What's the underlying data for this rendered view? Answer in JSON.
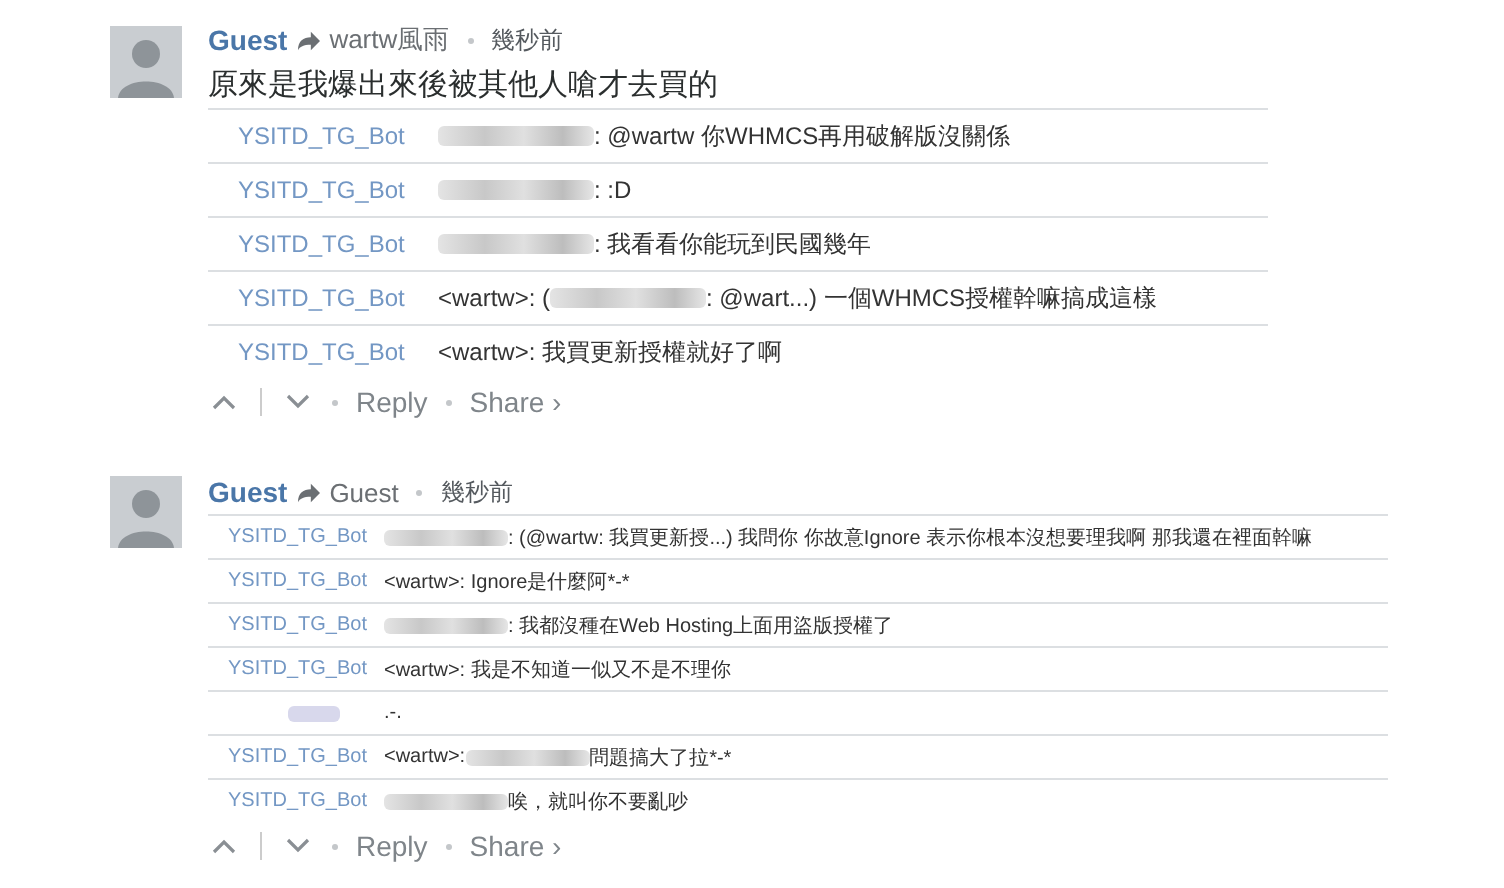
{
  "comments": [
    {
      "author": "Guest",
      "reply_to": "wartw風雨",
      "time": "幾秒前",
      "body": "原來是我爆出來後被其他人嗆才去買的",
      "compact": false,
      "lines": [
        {
          "author": "YSITD_TG_Bot",
          "parts": [
            {
              "kind": "blur"
            },
            {
              "kind": "text",
              "text": ": @wartw 你WHMCS再用破解版沒關係"
            }
          ]
        },
        {
          "author": "YSITD_TG_Bot",
          "parts": [
            {
              "kind": "blur"
            },
            {
              "kind": "text",
              "text": ": :D"
            }
          ]
        },
        {
          "author": "YSITD_TG_Bot",
          "parts": [
            {
              "kind": "blur"
            },
            {
              "kind": "text",
              "text": ": 我看看你能玩到民國幾年"
            }
          ]
        },
        {
          "author": "YSITD_TG_Bot",
          "parts": [
            {
              "kind": "text",
              "text": "<wartw>: ("
            },
            {
              "kind": "blur"
            },
            {
              "kind": "text",
              "text": ": @wart...) 一個WHMCS授權幹嘛搞成這樣"
            }
          ]
        },
        {
          "author": "YSITD_TG_Bot",
          "parts": [
            {
              "kind": "text",
              "text": "<wartw>: 我買更新授權就好了啊"
            }
          ]
        }
      ],
      "actions": [
        "Reply",
        "Share ›"
      ]
    },
    {
      "author": "Guest",
      "reply_to": "Guest",
      "time": "幾秒前",
      "compact": true,
      "lines": [
        {
          "author": "YSITD_TG_Bot",
          "parts": [
            {
              "kind": "blur"
            },
            {
              "kind": "text",
              "text": ": (@wartw: 我買更新授...) 我問你 你故意Ignore 表示你根本沒想要理我啊 那我還在裡面幹嘛"
            }
          ]
        },
        {
          "author": "YSITD_TG_Bot",
          "parts": [
            {
              "kind": "text",
              "text": "<wartw>: Ignore是什麼阿*-*"
            }
          ]
        },
        {
          "author": "YSITD_TG_Bot",
          "parts": [
            {
              "kind": "blur"
            },
            {
              "kind": "text",
              "text": ": 我都沒種在Web Hosting上面用盜版授權了"
            }
          ]
        },
        {
          "author": "YSITD_TG_Bot",
          "parts": [
            {
              "kind": "text",
              "text": "<wartw>: 我是不知道一似又不是不理你"
            }
          ]
        },
        {
          "parts": [
            {
              "kind": "text",
              "text": ".-."
            }
          ]
        },
        {
          "author": "YSITD_TG_Bot",
          "parts": [
            {
              "kind": "text",
              "text": "<wartw>:"
            },
            {
              "kind": "blur"
            },
            {
              "kind": "text",
              "text": "問題搞大了拉*-*"
            }
          ]
        },
        {
          "author": "YSITD_TG_Bot",
          "parts": [
            {
              "kind": "blur"
            },
            {
              "kind": "text",
              "text": "唉，就叫你不要亂吵"
            }
          ]
        }
      ],
      "actions": [
        "Reply",
        "Share ›"
      ]
    }
  ]
}
